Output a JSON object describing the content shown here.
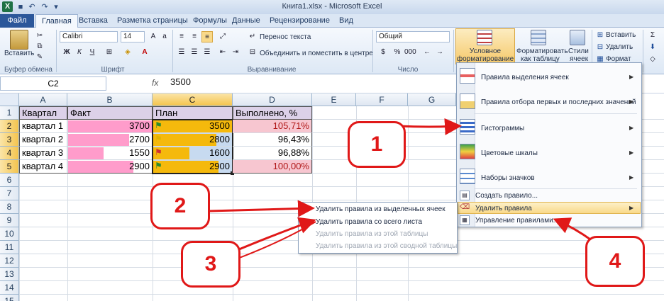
{
  "window": {
    "title": "Книга1.xlsx - Microsoft Excel"
  },
  "tabs": [
    "Файл",
    "Главная",
    "Вставка",
    "Разметка страницы",
    "Формулы",
    "Данные",
    "Рецензирование",
    "Вид"
  ],
  "ribbon": {
    "paste_label": "Вставить",
    "clipboard_label": "Буфер обмена",
    "font_name": "Calibri",
    "font_size": "14",
    "font_group_label": "Шрифт",
    "wrap_text": "Перенос текста",
    "merge_center": "Объединить и поместить в центре",
    "alignment_label": "Выравнивание",
    "number_format": "Общий",
    "number_label": "Число",
    "cf_line1": "Условное",
    "cf_line2": "форматирование",
    "fmt_table_line1": "Форматировать",
    "fmt_table_line2": "как таблицу",
    "styles_line1": "Стили",
    "styles_line2": "ячеек",
    "insert_cells": "Вставить",
    "delete_cells": "Удалить",
    "format_cells": "Формат",
    "bold": "Ж",
    "italic": "К",
    "underline": "Ч"
  },
  "formula_bar": {
    "name_box": "C2",
    "fx": "fx",
    "value": "3500"
  },
  "grid": {
    "columns": [
      "A",
      "B",
      "C",
      "D",
      "E",
      "F",
      "G"
    ],
    "rows": [
      "1",
      "2",
      "3",
      "4",
      "5",
      "6",
      "7",
      "8",
      "9",
      "10",
      "11",
      "12",
      "13",
      "14",
      "15"
    ],
    "data": [
      [
        "Квартал",
        "Факт",
        "План",
        "Выполнено, %"
      ],
      [
        "квартал 1",
        "3700",
        "3500",
        "105,71%"
      ],
      [
        "квартал 2",
        "2700",
        "2800",
        "96,43%"
      ],
      [
        "квартал 3",
        "1550",
        "1600",
        "96,88%"
      ],
      [
        "квартал 4",
        "2900",
        "2900",
        "100,00%"
      ]
    ],
    "fakt_bar_fill": [
      1.0,
      0.73,
      0.42,
      0.78
    ],
    "plan_bar_fill": [
      1.0,
      0.8,
      0.46,
      0.83
    ]
  },
  "cf_menu": {
    "items": [
      "Правила выделения ячеек",
      "Правила отбора первых и последних значений",
      "Гистограммы",
      "Цветовые шкалы",
      "Наборы значков"
    ],
    "create_rule": "Создать правило...",
    "delete_rules": "Удалить правила",
    "manage_rules": "Управление правилами..."
  },
  "delete_submenu": {
    "items": [
      "Удалить правила из выделенных ячеек",
      "Удалить правила со всего листа",
      "Удалить правила из этой таблицы",
      "Удалить правила из этой сводной таблицы"
    ]
  },
  "callouts": [
    "1",
    "2",
    "3",
    "4"
  ],
  "colors": {
    "callout_red": "#e01818",
    "pink_fill": "#f7c6d0",
    "bar_pink": "#ff9ccb",
    "bar_orange": "#f5b90c",
    "ribbon_active": "#f9d98a"
  }
}
